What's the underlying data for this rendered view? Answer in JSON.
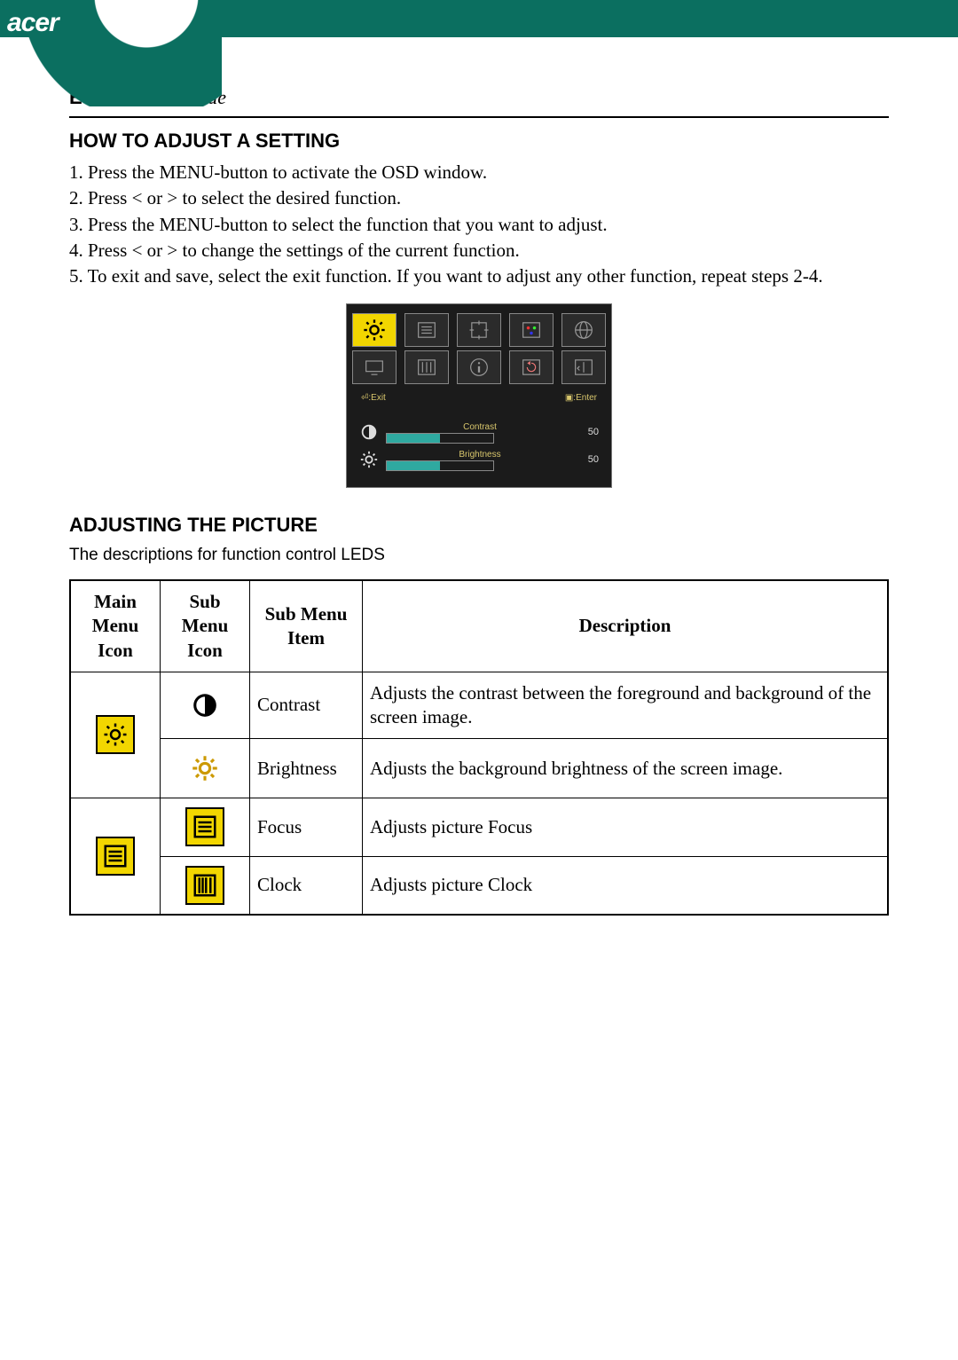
{
  "header": {
    "brand": "acer",
    "page_number": "E-10",
    "page_title": "User's Guide"
  },
  "section1": {
    "heading": "HOW TO ADJUST A SETTING",
    "steps": [
      "1.  Press the MENU-button  to activate the OSD window.",
      "2.  Press < or  > to select the desired function.",
      "3.  Press the MENU-button  to select the function that you want to adjust.",
      "4.  Press < or  > to change the settings of the current function.",
      "5.  To exit and save, select the exit function. If you want to adjust any other function, repeat steps 2-4."
    ]
  },
  "osd": {
    "exit_label": "⏎:Exit",
    "enter_label": "▣:Enter",
    "contrast_label": "Contrast",
    "contrast_value": "50",
    "brightness_label": "Brightness",
    "brightness_value": "50"
  },
  "section2": {
    "heading": "ADJUSTING THE PICTURE",
    "subtext": "The descriptions for function control LEDS"
  },
  "table": {
    "headers": {
      "main": "Main Menu Icon",
      "subicon": "Sub Menu Icon",
      "subitem": "Sub Menu Item",
      "desc": "Description"
    },
    "rows": [
      {
        "item": "Contrast",
        "desc": "Adjusts the contrast between the foreground and background of the screen image."
      },
      {
        "item": "Brightness",
        "desc": "Adjusts the background brightness of the screen image."
      },
      {
        "item": "Focus",
        "desc": "Adjusts picture Focus"
      },
      {
        "item": "Clock",
        "desc": "Adjusts picture Clock"
      }
    ]
  }
}
